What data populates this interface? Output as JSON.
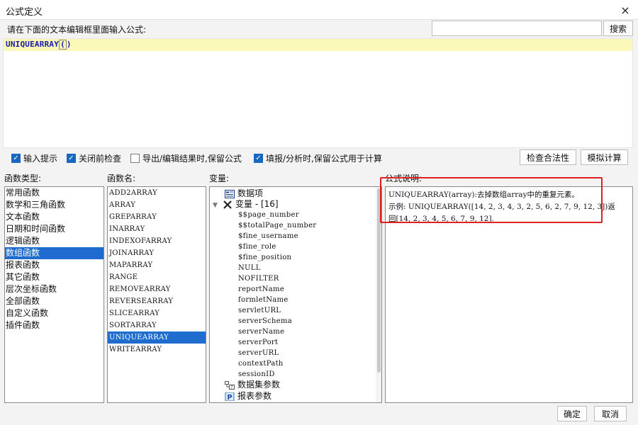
{
  "window": {
    "title": "公式定义",
    "close_symbol": "×"
  },
  "prompt": "请在下面的文本编辑框里面输入公式:",
  "search": {
    "value": "",
    "placeholder": "",
    "button": "搜索"
  },
  "editor": {
    "formula_name": "UNIQUEARRAY",
    "open_paren": "(",
    "close_paren": ")"
  },
  "options": [
    {
      "label": "输入提示",
      "checked": true
    },
    {
      "label": "关闭前检查",
      "checked": true
    },
    {
      "label": "导出/编辑结果时,保留公式",
      "checked": false
    },
    {
      "label": "填报/分析时,保留公式用于计算",
      "checked": true
    }
  ],
  "toolbar": {
    "check_label": "检查合法性",
    "simulate_label": "模拟计算"
  },
  "headings": {
    "categories": "函数类型:",
    "functions": "函数名:",
    "variables": "变量:",
    "description": "公式说明:"
  },
  "categories": [
    "常用函数",
    "数学和三角函数",
    "文本函数",
    "日期和时间函数",
    "逻辑函数",
    "数组函数",
    "报表函数",
    "其它函数",
    "层次坐标函数",
    "全部函数",
    "自定义函数",
    "插件函数"
  ],
  "selected_category": "数组函数",
  "functions": [
    "ADD2ARRAY",
    "ARRAY",
    "GREPARRAY",
    "INARRAY",
    "INDEXOFARRAY",
    "JOINARRAY",
    "MAPARRAY",
    "RANGE",
    "REMOVEARRAY",
    "REVERSEARRAY",
    "SLICEARRAY",
    "SORTARRAY",
    "UNIQUEARRAY",
    "WRITEARRAY"
  ],
  "selected_function": "UNIQUEARRAY",
  "variables": {
    "data_items": "数据项",
    "var_group": "变量 - [16]",
    "var_items": [
      "$$page_number",
      "$$totalPage_number",
      "$fine_username",
      "$fine_role",
      "$fine_position",
      "NULL",
      "NOFILTER",
      "reportName",
      "formletName",
      "servletURL",
      "serverSchema",
      "serverName",
      "serverPort",
      "serverURL",
      "contextPath",
      "sessionID"
    ],
    "dataset_params": "数据集参数",
    "report_params": "报表参数"
  },
  "description": {
    "line1": "UNIQUEARRAY(array):去掉数组array中的重复元素。",
    "line2": "示例: UNIQUEARRAY([14, 2, 3, 4, 3, 2, 5, 6, 2, 7, 9, 12, 3])返",
    "line3": "回[14, 2, 3, 4, 5, 6, 7, 9, 12]."
  },
  "footer": {
    "ok": "确定",
    "cancel": "取消"
  },
  "colors": {
    "selection": "#1e6ccd",
    "editor_line": "#fbf9b8",
    "formula": "#1a1aa8",
    "highlight_box": "#e02020"
  }
}
